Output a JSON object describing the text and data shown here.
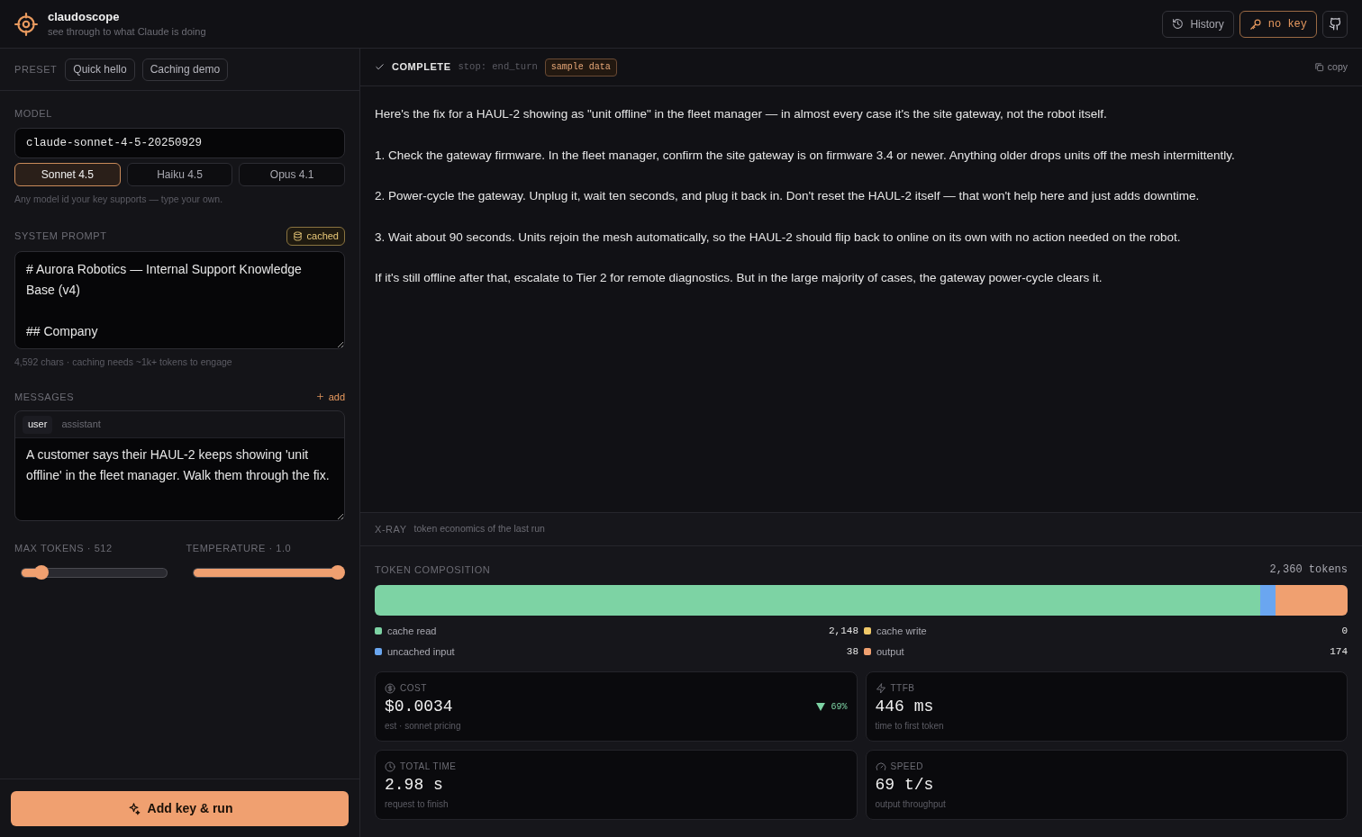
{
  "app": {
    "title": "claudoscope",
    "subtitle": "see through to what Claude is doing"
  },
  "header_buttons": [
    {
      "kind": "history",
      "label": "History"
    },
    {
      "kind": "key",
      "label": "no key"
    },
    {
      "kind": "github"
    }
  ],
  "preset": {
    "label": "PRESET",
    "options": [
      "Quick hello",
      "Caching demo"
    ]
  },
  "model": {
    "label": "MODEL",
    "value": "claude-sonnet-4-5-20250929",
    "hint": "Any model id your key supports — type your own.",
    "choices": [
      {
        "label": "Sonnet 4.5",
        "selected": true
      },
      {
        "label": "Haiku 4.5",
        "selected": false
      },
      {
        "label": "Opus 4.1",
        "selected": false
      }
    ]
  },
  "system_prompt": {
    "label": "SYSTEM PROMPT",
    "badge": "cached",
    "value": "# Aurora Robotics — Internal Support Knowledge Base (v4)\n\n## Company",
    "footer": "4,592 chars · caching needs ~1k+ tokens to engage"
  },
  "messages": {
    "label": "MESSAGES",
    "add": "add",
    "roles": [
      {
        "label": "user",
        "selected": true
      },
      {
        "label": "assistant",
        "selected": false
      }
    ],
    "value": "A customer says their HAUL-2 keeps showing 'unit offline' in the fleet manager. Walk them through the fix."
  },
  "params": [
    {
      "label": "MAX TOKENS · 512",
      "level": 0.14
    },
    {
      "label": "TEMPERATURE · 1.0",
      "level": 1
    }
  ],
  "run_button": "Add key & run",
  "response": {
    "status": "COMPLETE",
    "stop": "stop: end_turn",
    "badge": "sample data",
    "copy": "copy",
    "paragraphs": [
      "Here's the fix for a HAUL-2 showing as \"unit offline\" in the fleet manager — in almost every case it's the site gateway, not the robot itself.",
      "1. Check the gateway firmware. In the fleet manager, confirm the site gateway is on firmware 3.4 or newer. Anything older drops units off the mesh intermittently.",
      "2. Power-cycle the gateway. Unplug it, wait ten seconds, and plug it back in. Don't reset the HAUL-2 itself — that won't help here and just adds downtime.",
      "3. Wait about 90 seconds. Units rejoin the mesh automatically, so the HAUL-2 should flip back to online on its own with no action needed on the robot.",
      "If it's still offline after that, escalate to Tier 2 for remote diagnostics. But in the large majority of cases, the gateway power-cycle clears it."
    ]
  },
  "xray": {
    "title": "X-RAY",
    "subtitle": "token economics of the last run",
    "composition": {
      "label": "TOKEN COMPOSITION",
      "total": "2,360 tokens",
      "segments": [
        {
          "name": "cache read",
          "value": "2,148",
          "color": "#7dd3a4"
        },
        {
          "name": "uncached input",
          "value": "38",
          "color": "#6aa6f0"
        },
        {
          "name": "cache write",
          "value": "0",
          "color": "#f0c868"
        },
        {
          "name": "output",
          "value": "174",
          "color": "#f0a070"
        }
      ]
    },
    "metrics": [
      {
        "kind": "cost",
        "label": "COST",
        "value": "$0.0034",
        "note": "est · sonnet pricing",
        "delta": "69%"
      },
      {
        "kind": "ttfb",
        "label": "TTFB",
        "value": "446 ms",
        "note": "time to first token"
      },
      {
        "kind": "total_time",
        "label": "TOTAL TIME",
        "value": "2.98 s",
        "note": "request to finish"
      },
      {
        "kind": "speed",
        "label": "SPEED",
        "value": "69 t/s",
        "note": "output throughput"
      }
    ]
  }
}
